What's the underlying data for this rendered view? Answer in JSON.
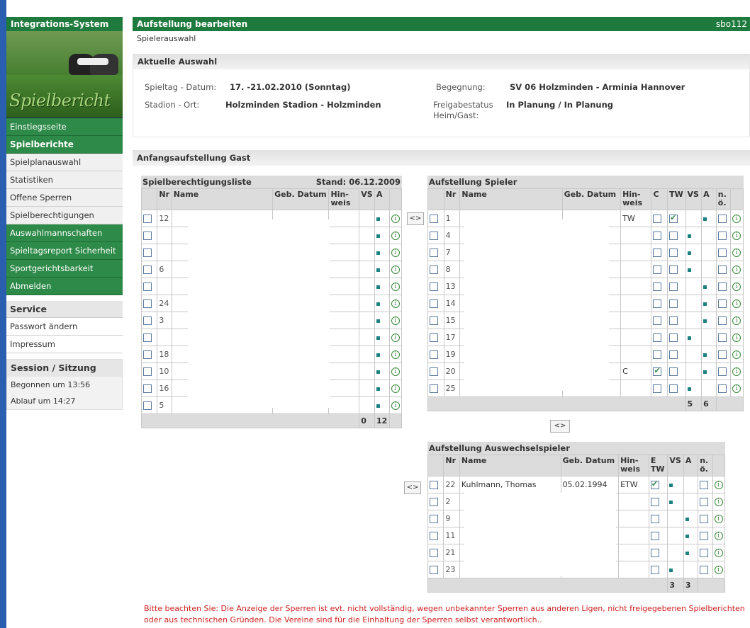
{
  "sidebar": {
    "header": "Integrations-System",
    "banner_title": "Spielbericht",
    "items": [
      {
        "label": "Einstiegsseite",
        "style": "green"
      },
      {
        "label": "Spielberichte",
        "style": "green-bold"
      },
      {
        "label": "Spielplanauswahl",
        "style": "light"
      },
      {
        "label": "Statistiken",
        "style": "light"
      },
      {
        "label": "Offene Sperren",
        "style": "light"
      },
      {
        "label": "Spielberechtigungen",
        "style": "light"
      },
      {
        "label": "Auswahlmannschaften",
        "style": "green"
      },
      {
        "label": "Spieltagsreport Sicherheit",
        "style": "green"
      },
      {
        "label": "Sportgerichtsbarkeit",
        "style": "green"
      },
      {
        "label": "Abmelden",
        "style": "green"
      }
    ],
    "service": {
      "title": "Service",
      "items": [
        "Passwort ändern",
        "Impressum"
      ]
    },
    "session": {
      "title": "Session / Sitzung",
      "started": "Begonnen um 13:56",
      "expires": "Ablauf um 14:27"
    }
  },
  "main": {
    "title": "Aufstellung bearbeiten",
    "user_id": "sbo112",
    "subtitle": "Spielerauswahl",
    "current_selection": {
      "title": "Aktuelle Auswahl",
      "spieltag_label": "Spieltag - Datum:",
      "spieltag_value": "17. -21.02.2010 (Sonntag)",
      "stadion_label": "Stadion - Ort:",
      "stadion_value": "Holzminden Stadion - Holzminden",
      "begegnung_label": "Begegnung:",
      "begegnung_value": "SV 06 Holzminden - Arminia Hannover",
      "freigabe_label_1": "Freigabestatus",
      "freigabe_label_2": "Heim/Gast:",
      "freigabe_value": "In Planung / In Planung"
    },
    "lineup_title": "Anfangsaufstellung Gast",
    "eligibility": {
      "title": "Spielberechtigungsliste",
      "stand": "Stand: 06.12.2009",
      "headers": {
        "nr": "Nr",
        "name": "Name",
        "geb": "Geb. Datum",
        "hinweis": "Hin- weis",
        "vs": "VS",
        "a": "A"
      },
      "rows": [
        {
          "nr": "12"
        },
        {
          "nr": ""
        },
        {
          "nr": ""
        },
        {
          "nr": "6"
        },
        {
          "nr": ""
        },
        {
          "nr": "24"
        },
        {
          "nr": "3"
        },
        {
          "nr": ""
        },
        {
          "nr": "18"
        },
        {
          "nr": "10"
        },
        {
          "nr": "16"
        },
        {
          "nr": "5"
        }
      ],
      "sum_vs": "0",
      "sum_a": "12"
    },
    "players": {
      "title": "Aufstellung Spieler",
      "headers": {
        "nr": "Nr",
        "name": "Name",
        "geb": "Geb. Datum",
        "hinweis": "Hin- weis",
        "c": "C",
        "tw": "TW",
        "vs": "VS",
        "a": "A",
        "no": "n. ö."
      },
      "rows": [
        {
          "nr": "1",
          "hinweis": "TW",
          "c": false,
          "tw": true,
          "vs": false,
          "a": true
        },
        {
          "nr": "4",
          "hinweis": "",
          "c": false,
          "tw": false,
          "vs": true,
          "a": false
        },
        {
          "nr": "7",
          "hinweis": "",
          "c": false,
          "tw": false,
          "vs": true,
          "a": false
        },
        {
          "nr": "8",
          "hinweis": "",
          "c": false,
          "tw": false,
          "vs": true,
          "a": false
        },
        {
          "nr": "13",
          "hinweis": "",
          "c": false,
          "tw": false,
          "vs": false,
          "a": true
        },
        {
          "nr": "14",
          "hinweis": "",
          "c": false,
          "tw": false,
          "vs": false,
          "a": true
        },
        {
          "nr": "15",
          "hinweis": "",
          "c": false,
          "tw": false,
          "vs": false,
          "a": true
        },
        {
          "nr": "17",
          "hinweis": "",
          "c": false,
          "tw": false,
          "vs": true,
          "a": false
        },
        {
          "nr": "19",
          "hinweis": "",
          "c": false,
          "tw": false,
          "vs": false,
          "a": true
        },
        {
          "nr": "20",
          "hinweis": "C",
          "c": true,
          "tw": false,
          "vs": false,
          "a": true
        },
        {
          "nr": "25",
          "hinweis": "",
          "c": false,
          "tw": false,
          "vs": true,
          "a": false
        }
      ],
      "sum_vs": "5",
      "sum_a": "6"
    },
    "subs": {
      "title": "Aufstellung Auswechselspieler",
      "headers": {
        "nr": "Nr",
        "name": "Name",
        "geb": "Geb. Datum",
        "hinweis": "Hin- weis",
        "etw": "E TW",
        "vs": "VS",
        "a": "A",
        "no": "n. ö."
      },
      "rows": [
        {
          "nr": "22",
          "name": "Kuhlmann, Thomas",
          "geb": "05.02.1994",
          "hinweis": "ETW",
          "etw": true,
          "vs": true,
          "a": false
        },
        {
          "nr": "2",
          "name": "",
          "geb": "",
          "hinweis": "",
          "etw": false,
          "vs": true,
          "a": false
        },
        {
          "nr": "9",
          "name": "",
          "geb": "",
          "hinweis": "",
          "etw": false,
          "vs": false,
          "a": true
        },
        {
          "nr": "11",
          "name": "",
          "geb": "",
          "hinweis": "",
          "etw": false,
          "vs": false,
          "a": true
        },
        {
          "nr": "21",
          "name": "",
          "geb": "",
          "hinweis": "",
          "etw": false,
          "vs": false,
          "a": true
        },
        {
          "nr": "23",
          "name": "",
          "geb": "",
          "hinweis": "",
          "etw": false,
          "vs": true,
          "a": false
        }
      ],
      "sum_vs": "3",
      "sum_a": "3"
    },
    "swap_label": "<>",
    "notice": "Bitte beachten Sie: Die Anzeige der Sperren ist evt. nicht vollständig, wegen unbekannter Sperren aus anderen Ligen, nicht freigegebenen Spielberichten oder aus technischen Gründen. Die Vereine sind für die Einhaltung der Sperren selbst verantwortlich.."
  }
}
